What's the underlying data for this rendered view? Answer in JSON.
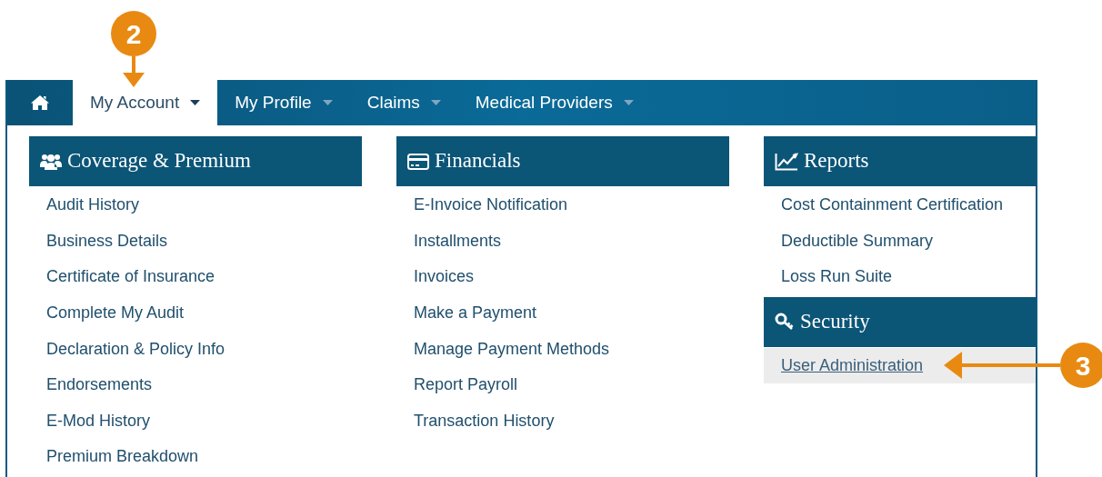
{
  "callouts": [
    {
      "label": "2",
      "kind": "down"
    },
    {
      "label": "3",
      "kind": "left"
    }
  ],
  "nav": {
    "tabs": [
      {
        "kind": "home",
        "selected": false
      },
      {
        "kind": "text",
        "label": "My Account",
        "selected": true,
        "dropdown": true
      },
      {
        "kind": "text",
        "label": "My Profile",
        "selected": false,
        "dropdown": true
      },
      {
        "kind": "text",
        "label": "Claims",
        "selected": false,
        "dropdown": true
      },
      {
        "kind": "text",
        "label": "Medical Providers",
        "selected": false,
        "dropdown": true
      }
    ]
  },
  "columns": [
    {
      "sections": [
        {
          "title": "Coverage & Premium",
          "items": [
            {
              "label": "Audit History",
              "selected": false
            },
            {
              "label": "Business Details",
              "selected": false
            },
            {
              "label": "Certificate of Insurance",
              "selected": false
            },
            {
              "label": "Complete My Audit",
              "selected": false
            },
            {
              "label": "Declaration & Policy Info",
              "selected": false
            },
            {
              "label": "Endorsements",
              "selected": false
            },
            {
              "label": "E-Mod History",
              "selected": false
            },
            {
              "label": "Premium Breakdown",
              "selected": false
            }
          ]
        }
      ]
    },
    {
      "sections": [
        {
          "title": "Financials",
          "items": [
            {
              "label": "E-Invoice Notification",
              "selected": false
            },
            {
              "label": "Installments",
              "selected": false
            },
            {
              "label": "Invoices",
              "selected": false
            },
            {
              "label": "Make a Payment",
              "selected": false
            },
            {
              "label": "Manage Payment Methods",
              "selected": false
            },
            {
              "label": "Report Payroll",
              "selected": false
            },
            {
              "label": "Transaction History",
              "selected": false
            }
          ]
        }
      ]
    },
    {
      "sections": [
        {
          "title": "Reports",
          "items": [
            {
              "label": "Cost Containment Certification",
              "selected": false
            },
            {
              "label": "Deductible Summary",
              "selected": false
            },
            {
              "label": "Loss Run Suite",
              "selected": false
            }
          ]
        },
        {
          "title": "Security",
          "items": [
            {
              "label": "User Administration",
              "selected": true
            }
          ]
        }
      ]
    }
  ]
}
